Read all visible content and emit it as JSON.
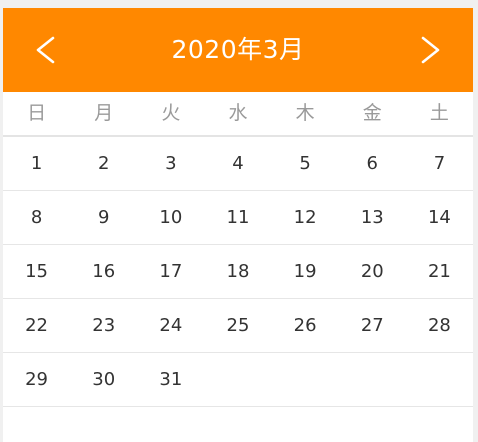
{
  "header": {
    "title": "2020年3月",
    "prev_icon": "chevron-left-icon",
    "next_icon": "chevron-right-icon",
    "accent_color": "#ff8800"
  },
  "weekdays": [
    "日",
    "月",
    "火",
    "水",
    "木",
    "金",
    "土"
  ],
  "weeks": [
    [
      "1",
      "2",
      "3",
      "4",
      "5",
      "6",
      "7"
    ],
    [
      "8",
      "9",
      "10",
      "11",
      "12",
      "13",
      "14"
    ],
    [
      "15",
      "16",
      "17",
      "18",
      "19",
      "20",
      "21"
    ],
    [
      "22",
      "23",
      "24",
      "25",
      "26",
      "27",
      "28"
    ],
    [
      "29",
      "30",
      "31",
      "",
      "",
      "",
      ""
    ],
    [
      "",
      "",
      "",
      "",
      "",
      "",
      ""
    ]
  ]
}
